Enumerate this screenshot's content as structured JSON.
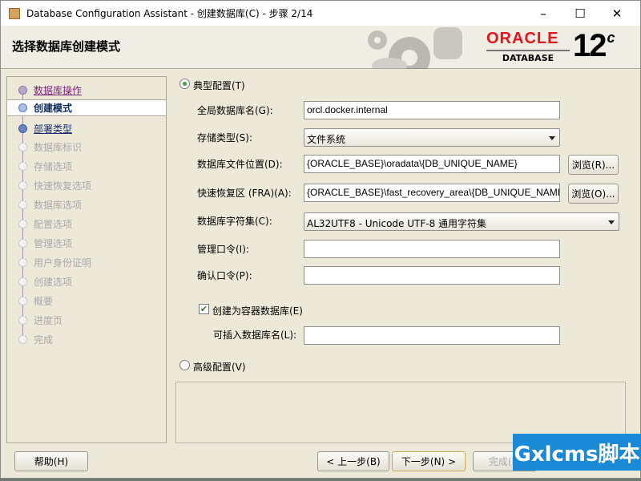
{
  "window": {
    "title": "Database Configuration Assistant - 创建数据库(C) - 步骤 2/14",
    "minimize": "–",
    "maximize": "☐",
    "close": "✕"
  },
  "header": {
    "title": "选择数据库创建模式",
    "logo_oracle": "ORACLE",
    "logo_database": "DATABASE",
    "logo_version": "12",
    "logo_version_suffix": "c"
  },
  "sidebar": {
    "steps": [
      {
        "label": "数据库操作",
        "state": "done"
      },
      {
        "label": "创建模式",
        "state": "current"
      },
      {
        "label": "部署类型",
        "state": "next"
      },
      {
        "label": "数据库标识",
        "state": "disabled"
      },
      {
        "label": "存储选项",
        "state": "disabled"
      },
      {
        "label": "快速恢复选项",
        "state": "disabled"
      },
      {
        "label": "数据库选项",
        "state": "disabled"
      },
      {
        "label": "配置选项",
        "state": "disabled"
      },
      {
        "label": "管理选项",
        "state": "disabled"
      },
      {
        "label": "用户身份证明",
        "state": "disabled"
      },
      {
        "label": "创建选项",
        "state": "disabled"
      },
      {
        "label": "概要",
        "state": "disabled"
      },
      {
        "label": "进度页",
        "state": "disabled"
      },
      {
        "label": "完成",
        "state": "disabled"
      }
    ]
  },
  "form": {
    "typical_label": "典型配置(T)",
    "typical_selected": true,
    "global_db_name_label": "全局数据库名(G):",
    "global_db_name": "orcl.docker.internal",
    "storage_type_label": "存储类型(S):",
    "storage_type": "文件系统",
    "db_file_location_label": "数据库文件位置(D):",
    "db_file_location": "{ORACLE_BASE}\\oradata\\{DB_UNIQUE_NAME}",
    "browse_r": "浏览(R)...",
    "fra_label": "快速恢复区 (FRA)(A):",
    "fra": "{ORACLE_BASE}\\fast_recovery_area\\{DB_UNIQUE_NAME}",
    "browse_o": "浏览(O)...",
    "charset_label": "数据库字符集(C):",
    "charset": "AL32UTF8 - Unicode UTF-8 通用字符集",
    "admin_pwd_label": "管理口令(I):",
    "admin_pwd": "",
    "confirm_pwd_label": "确认口令(P):",
    "confirm_pwd": "",
    "container_label": "创建为容器数据库(E)",
    "container_checked": true,
    "pdb_name_label": "可插入数据库名(L):",
    "pdb_name": "",
    "advanced_label": "高级配置(V)",
    "advanced_selected": false
  },
  "footer": {
    "help": "帮助(H)",
    "back": "< 上一步(B)",
    "next": "下一步(N) >",
    "finish": "完成(F)"
  },
  "watermark": "Gxlcms脚本"
}
